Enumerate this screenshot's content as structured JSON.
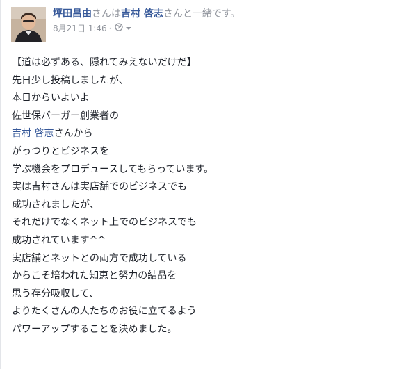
{
  "post": {
    "author": "坪田昌由",
    "with_text": "さんは",
    "tagged": "吉村 啓志",
    "with_suffix": "さんと一緒です。",
    "timestamp": "8月21日 1:46",
    "separator": "·",
    "privacy_icon": "globe-icon",
    "menu_icon": "chevron-down-icon",
    "mention_name": "吉村 啓志",
    "mention_suffix": "さんから",
    "lines": [
      "【道は必ずある、隠れてみえないだけだ】",
      "先日少し投稿しましたが、",
      "本日からいよいよ",
      "佐世保バーガー創業者の",
      "",
      "がっつりとビジネスを",
      "学ぶ機会をプロデュースしてもらっています。",
      "実は吉村さんは実店舗でのビジネスでも",
      "成功されましたが、",
      "それだけでなくネット上でのビジネスでも",
      "成功されています^^",
      "実店舗とネットとの両方で成功している",
      "からこそ培われた知恵と努力の結晶を",
      "思う存分吸収して、",
      "よりたくさんの人たちのお役に立てるよう",
      "パワーアップすることを決めました。"
    ]
  },
  "colors": {
    "link": "#365899",
    "meta": "#90949c",
    "text": "#1d2129"
  }
}
